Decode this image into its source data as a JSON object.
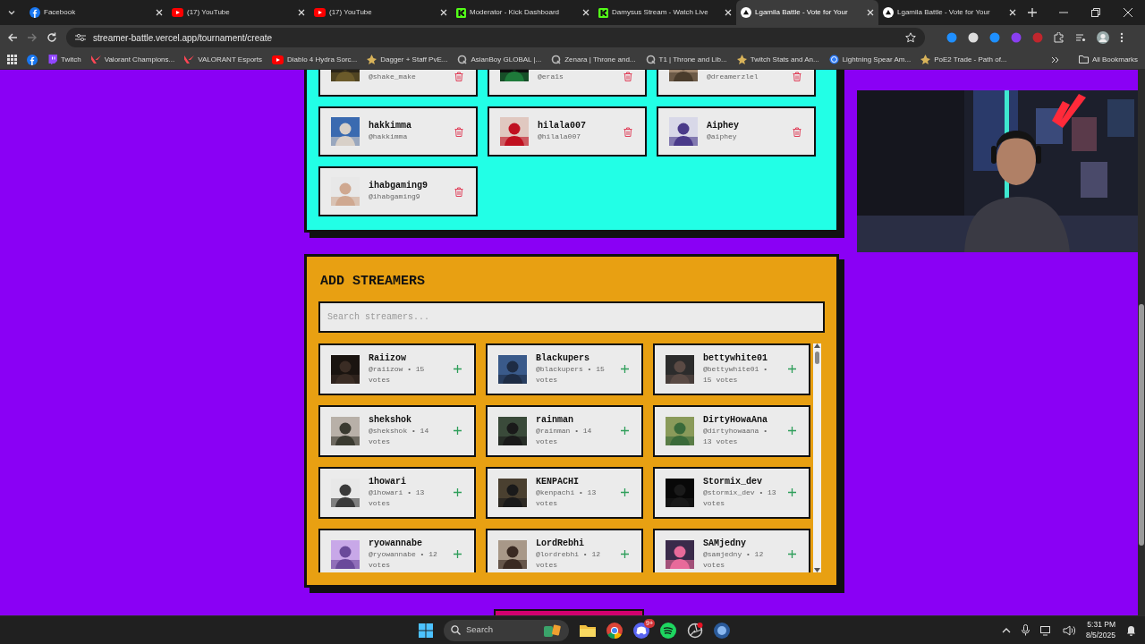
{
  "browser": {
    "tabs": [
      {
        "kind": "facebook",
        "title": "Facebook",
        "selected": false
      },
      {
        "kind": "youtube",
        "title": "(17) YouTube",
        "selected": false
      },
      {
        "kind": "youtube",
        "title": "(17) YouTube",
        "selected": false
      },
      {
        "kind": "kick",
        "title": "Moderator - Kick Dashboard",
        "selected": false
      },
      {
        "kind": "kick",
        "title": "Damysus Stream - Watch Live",
        "selected": false
      },
      {
        "kind": "site",
        "title": "Lgamila Battle - Vote for Your",
        "selected": true
      },
      {
        "kind": "site",
        "title": "Lgamila Battle - Vote for Your",
        "selected": false
      }
    ],
    "url": "streamer-battle.vercel.app/tournament/create",
    "bookmarks": [
      {
        "kind": "facebook"
      },
      {
        "kind": "twitch",
        "label": "Twitch"
      },
      {
        "kind": "valorant",
        "label": "Valorant Champions..."
      },
      {
        "kind": "valorant",
        "label": "VALORANT Esports"
      },
      {
        "kind": "youtube",
        "label": "Diablo 4 Hydra Sorc..."
      },
      {
        "kind": "game",
        "label": "Dagger + Staff PvE..."
      },
      {
        "kind": "circle",
        "label": "AsianBoy GLOBAL |..."
      },
      {
        "kind": "circle",
        "label": "Zenara | Throne and..."
      },
      {
        "kind": "circle",
        "label": "T1 | Throne and Lib..."
      },
      {
        "kind": "game",
        "label": "Twitch Stats and An..."
      },
      {
        "kind": "globe",
        "label": "Lightning Spear Am..."
      },
      {
        "kind": "game",
        "label": "PoE2 Trade - Path of..."
      }
    ],
    "all_bookmarks": "All Bookmarks"
  },
  "selected_streamers": [
    {
      "handle": "@shake_make"
    },
    {
      "handle": "@era1s"
    },
    {
      "handle": "@dreamerzlel"
    },
    {
      "name": "hakkimma",
      "handle": "@hakkimma"
    },
    {
      "name": "hilala007",
      "handle": "@hilala007"
    },
    {
      "name": "Aiphey",
      "handle": "@aiphey"
    },
    {
      "name": "ihabgaming9",
      "handle": "@ihabgaming9"
    }
  ],
  "add_streamers": {
    "title": "ADD STREAMERS",
    "search": {
      "placeholder": "Search streamers..."
    },
    "streamers": [
      {
        "name": "Raiizow",
        "meta": "@raiizow • 15 votes"
      },
      {
        "name": "Blackupers",
        "meta": "@blackupers • 15 votes"
      },
      {
        "name": "bettywhite01",
        "meta": "@bettywhite01 • 15 votes"
      },
      {
        "name": "shekshok",
        "meta": "@shekshok • 14 votes"
      },
      {
        "name": "rainman",
        "meta": "@rainman • 14 votes"
      },
      {
        "name": "DirtyHowaAna",
        "meta": "@dirtyhowaana • 13 votes"
      },
      {
        "name": "1howari",
        "meta": "@1howari • 13 votes"
      },
      {
        "name": "KENPACHI",
        "meta": "@kenpachi • 13 votes"
      },
      {
        "name": "Stormix_dev",
        "meta": "@stormix_dev • 13 votes"
      },
      {
        "name": "ryowannabe",
        "meta": "@ryowannabe • 12 votes"
      },
      {
        "name": "LordRebhi",
        "meta": "@lordrebhi • 12 votes"
      },
      {
        "name": "SAMjedny",
        "meta": "@samjedny • 12 votes"
      }
    ]
  },
  "taskbar": {
    "search": "Search",
    "discord_badge": "9+",
    "time": "5:31 PM",
    "date": "8/5/2025"
  }
}
